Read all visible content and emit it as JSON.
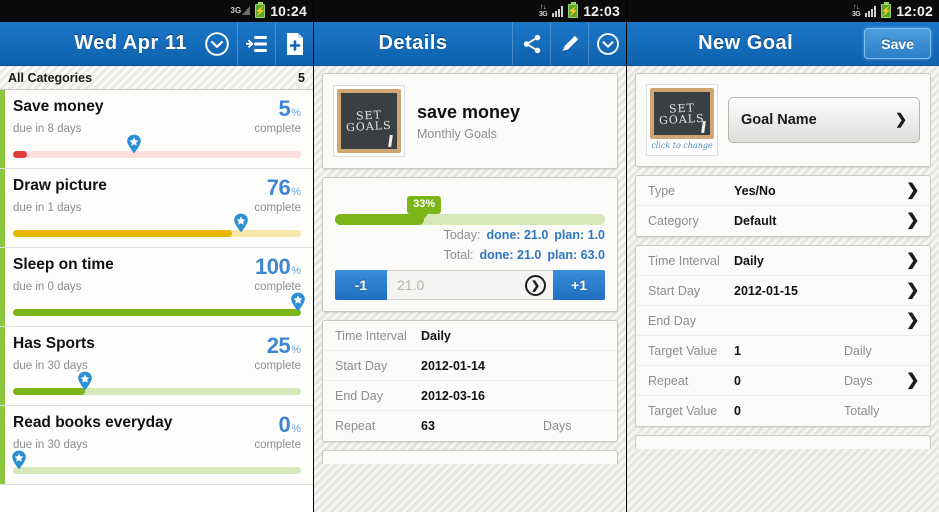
{
  "panels": {
    "list": {
      "status": {
        "network": "3G",
        "time": "10:24"
      },
      "header": {
        "title": "Wed  Apr  11",
        "dropdown_icon": "chevron-down-circle-icon",
        "sort_icon": "sort-list-icon",
        "add_icon": "new-document-plus-icon"
      },
      "category_bar": {
        "label": "All Categories",
        "count": "5"
      },
      "goals": [
        {
          "name": "Save money",
          "percent": "5",
          "pct_unit": "%",
          "due": "due in 8 days",
          "complete": "complete",
          "progress": 5,
          "marker": 42,
          "bar_fill": "#e23b3b",
          "bar_track": "#fadede",
          "accent": "#8cc63e"
        },
        {
          "name": "Draw picture",
          "percent": "76",
          "pct_unit": "%",
          "due": "due in 1 days",
          "complete": "complete",
          "progress": 76,
          "marker": 79,
          "bar_fill": "#e8b800",
          "bar_track": "#f6e7a8",
          "accent": "#8cc63e"
        },
        {
          "name": "Sleep on time",
          "percent": "100",
          "pct_unit": "%",
          "due": "due in 0 days",
          "complete": "complete",
          "progress": 100,
          "marker": 99,
          "bar_fill": "#7cb518",
          "bar_track": "#d7e8b8",
          "accent": "#8cc63e"
        },
        {
          "name": "Has Sports",
          "percent": "25",
          "pct_unit": "%",
          "due": "due in 30 days",
          "complete": "complete",
          "progress": 25,
          "marker": 25,
          "bar_fill": "#7cb518",
          "bar_track": "#d7e8b8",
          "accent": "#8cc63e"
        },
        {
          "name": "Read books everyday",
          "percent": "0",
          "pct_unit": "%",
          "due": "due in 30 days",
          "complete": "complete",
          "progress": 0,
          "marker": 2,
          "bar_fill": "#7cb518",
          "bar_track": "#d7e8b8",
          "accent": "#8cc63e"
        }
      ]
    },
    "details": {
      "status": {
        "network": "3G",
        "time": "12:03"
      },
      "header": {
        "title": "Details",
        "share_icon": "share-icon",
        "edit_icon": "pencil-edit-icon",
        "dropdown_icon": "chevron-down-circle-icon"
      },
      "goal": {
        "title": "save money",
        "subtitle": "Monthly Goals",
        "thumb_text_1": "SET",
        "thumb_text_2": "GOALS"
      },
      "progress": {
        "badge": "33%",
        "percent": 33
      },
      "stats": [
        {
          "label": "Today:",
          "done_label": "done: 21.0",
          "plan_label": "plan: 1.0"
        },
        {
          "label": "Total:",
          "done_label": "done: 21.0",
          "plan_label": "plan: 63.0"
        }
      ],
      "stepper": {
        "minus": "-1",
        "plus": "+1",
        "value": "21.0",
        "go_icon": "arrow-right-circle-icon"
      },
      "info_rows": [
        {
          "label": "Time Interval",
          "value": "Daily",
          "unit": ""
        },
        {
          "label": "Start Day",
          "value": "2012-01-14",
          "unit": ""
        },
        {
          "label": "End Day",
          "value": "2012-03-16",
          "unit": ""
        },
        {
          "label": "Repeat",
          "value": "63",
          "unit": "Days"
        }
      ]
    },
    "newgoal": {
      "status": {
        "network": "3G",
        "time": "12:02"
      },
      "header": {
        "title": "New Goal",
        "save_label": "Save"
      },
      "name_field": {
        "label": "Goal Name",
        "chevron_icon": "chevron-right-icon",
        "thumb_text_1": "SET",
        "thumb_text_2": "GOALS",
        "thumb_caption": "click to change"
      },
      "group1": [
        {
          "label": "Type",
          "value": "Yes/No",
          "unit": "",
          "chevron": true
        },
        {
          "label": "Category",
          "value": "Default",
          "unit": "",
          "chevron": true
        }
      ],
      "group2": [
        {
          "label": "Time Interval",
          "value": "Daily",
          "unit": "",
          "chevron": true
        },
        {
          "label": "Start Day",
          "value": "2012-01-15",
          "unit": "",
          "chevron": true
        },
        {
          "label": "End Day",
          "value": "",
          "unit": "",
          "chevron": true
        },
        {
          "label": "Target Value",
          "value": "1",
          "unit": "Daily",
          "chevron": false
        },
        {
          "label": "Repeat",
          "value": "0",
          "unit": "Days",
          "chevron": true
        },
        {
          "label": "Target Value",
          "value": "0",
          "unit": "Totally",
          "chevron": false
        }
      ]
    }
  }
}
